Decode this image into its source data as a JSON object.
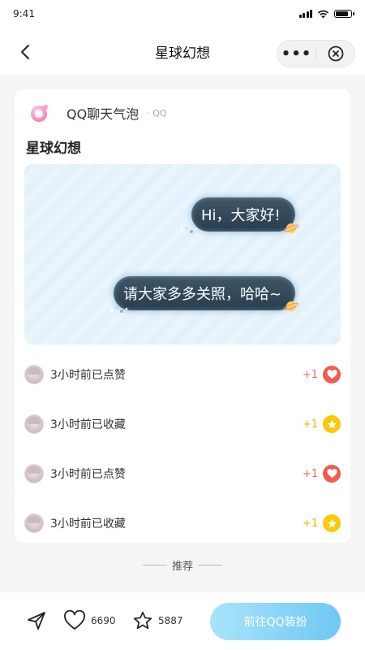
{
  "status_bar": {
    "time": "9:41"
  },
  "nav": {
    "title": "星球幻想",
    "more_label": "•••"
  },
  "card": {
    "app_name": "QQ聊天气泡",
    "app_tag": "· QQ",
    "item_title": "星球幻想",
    "bubbles": [
      "Hi，大家好!",
      "请大家多多关照，哈哈~"
    ]
  },
  "activities": [
    {
      "text": "3小时前已点赞",
      "plus": "+1",
      "type": "like",
      "icon": "heart-icon",
      "color": "#f25b4f"
    },
    {
      "text": "3小时前已收藏",
      "plus": "+1",
      "type": "favorite",
      "icon": "star-icon",
      "color": "#f9c90b"
    },
    {
      "text": "3小时前已点赞",
      "plus": "+1",
      "type": "like",
      "icon": "heart-icon",
      "color": "#f25b4f"
    },
    {
      "text": "3小时前已收藏",
      "plus": "+1",
      "type": "favorite",
      "icon": "star-icon",
      "color": "#f9c90b"
    }
  ],
  "recommend": {
    "label": "推荐"
  },
  "bottom_bar": {
    "like_count": "6690",
    "favorite_count": "5887",
    "cta_label": "前往QQ装扮"
  },
  "colors": {
    "accent": "#6fc8f3",
    "like": "#f25b4f",
    "favorite": "#f9c90b"
  }
}
